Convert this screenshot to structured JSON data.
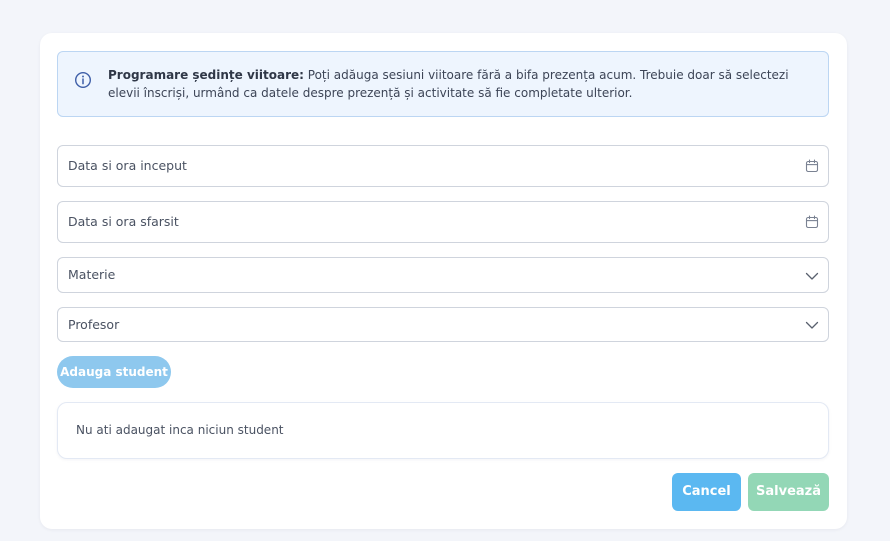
{
  "info": {
    "title": "Programare ședințe viitoare:",
    "text": " Poți adăuga sesiuni viitoare fără a bifa prezența acum. Trebuie doar să selectezi elevii înscriși, urmând ca datele despre prezență și activitate să fie completate ulterior.",
    "icon": "info-icon"
  },
  "fields": {
    "start": {
      "label": "Data si ora inceput",
      "icon": "calendar-icon"
    },
    "end": {
      "label": "Data si ora sfarsit",
      "icon": "calendar-icon"
    },
    "materie": {
      "label": "Materie",
      "icon": "chevron-down-icon"
    },
    "profesor": {
      "label": "Profesor",
      "icon": "chevron-down-icon"
    }
  },
  "add_student_label": "Adauga student",
  "students": {
    "empty_message": "Nu ati adaugat inca niciun student"
  },
  "actions": {
    "cancel_label": "Cancel",
    "save_label": "Salvează"
  },
  "colors": {
    "page_bg": "#f3f5fa",
    "info_bg": "#eef5fe",
    "info_border": "#bcd6f3",
    "add_student": "#8ec8ee",
    "cancel": "#5bb8f1",
    "save": "#93d7b6"
  }
}
